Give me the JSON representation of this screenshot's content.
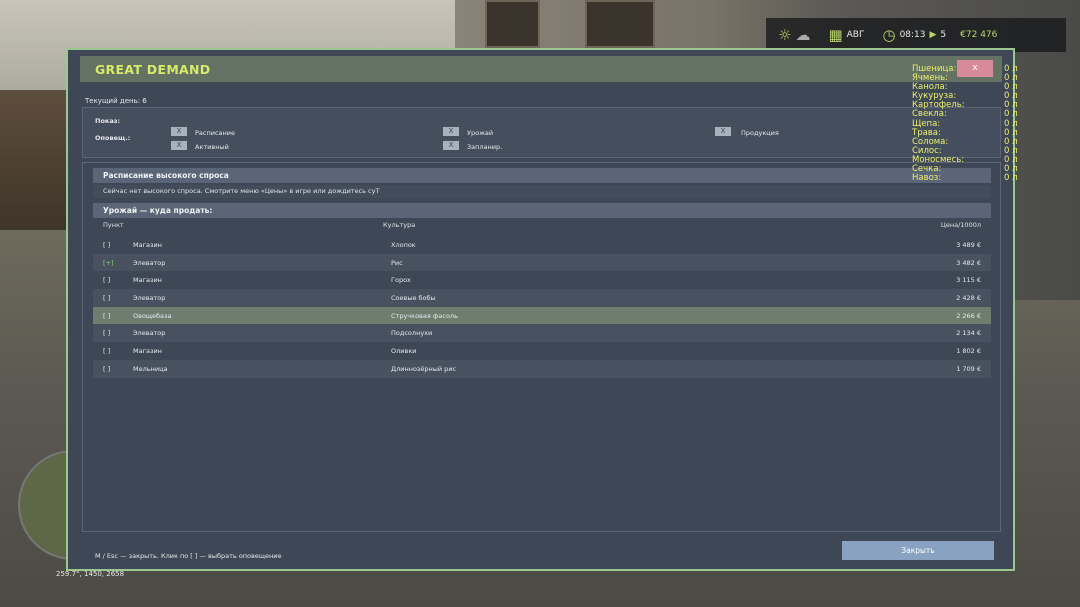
{
  "hud": {
    "month": "АВГ",
    "time": "08:13",
    "speed": "5",
    "money": "€72 476",
    "icons": [
      "sun-icon",
      "cloud-icon",
      "calendar-icon",
      "clock-icon",
      "money-icon"
    ]
  },
  "world": {
    "coords": "259.7°, 1450, 2658"
  },
  "dialog": {
    "title": "GREAT DEMAND",
    "close_x": "x",
    "current_day": "Текущий день: 6",
    "filters": {
      "show_label": "Показ:",
      "notify_label": "Оповещ.:",
      "checks": [
        {
          "mark": "X",
          "label": "Расписание"
        },
        {
          "mark": "X",
          "label": "Урожай"
        },
        {
          "mark": "X",
          "label": "Продукция"
        },
        {
          "mark": "X",
          "label": "Активный"
        },
        {
          "mark": "X",
          "label": "Запланир."
        }
      ]
    },
    "schedule": {
      "title": "Расписание высокого спроса",
      "notice": "Сейчас нет высокого спроса. Смотрите меню «Цены» в игре или дождитесь суТ"
    },
    "harvest": {
      "title": "Урожай — куда продать:",
      "columns": {
        "point": "Пункт",
        "crop": "Культура",
        "price": "Цена/1000л"
      },
      "rows": [
        {
          "mark": "[ ]",
          "point": "Магазин",
          "crop": "Хлопок",
          "price": "3 489 €"
        },
        {
          "mark": "[+]",
          "point": "Элеватор",
          "crop": "Рис",
          "price": "3 482 €"
        },
        {
          "mark": "[ ]",
          "point": "Магазин",
          "crop": "Горох",
          "price": "3 115 €"
        },
        {
          "mark": "[ ]",
          "point": "Элеватор",
          "crop": "Соевые бобы",
          "price": "2 428 €"
        },
        {
          "mark": "[ ]",
          "point": "Овощебаза",
          "crop": "Стручковая фасоль",
          "price": "2 266 €"
        },
        {
          "mark": "[ ]",
          "point": "Элеватор",
          "crop": "Подсолнухи",
          "price": "2 134 €"
        },
        {
          "mark": "[ ]",
          "point": "Магазин",
          "crop": "Оливки",
          "price": "1 802 €"
        },
        {
          "mark": "[ ]",
          "point": "Мельница",
          "crop": "Длиннозёрный рис",
          "price": "1 709 €"
        }
      ]
    },
    "footer_hint": "M / Esc — закрыть. Клик по [ ] — выбрать оповещение",
    "close_button": "Закрыть"
  },
  "overlay": [
    {
      "name": "Пшеница:",
      "value": "0 л"
    },
    {
      "name": "Ячмень:",
      "value": "0 л"
    },
    {
      "name": "Канола:",
      "value": "0 л"
    },
    {
      "name": "Кукуруза:",
      "value": "0 л"
    },
    {
      "name": "Картофель:",
      "value": "0 л"
    },
    {
      "name": "Свекла:",
      "value": "0 л"
    },
    {
      "name": "Щепа:",
      "value": "0 л"
    },
    {
      "name": "Трава:",
      "value": "0 л"
    },
    {
      "name": "Солома:",
      "value": "0 л"
    },
    {
      "name": "Силос:",
      "value": "0 л"
    },
    {
      "name": "Моносмесь:",
      "value": "0 л"
    },
    {
      "name": "Сечка:",
      "value": "0 л"
    },
    {
      "name": "Навоз:",
      "value": "0 л"
    }
  ]
}
